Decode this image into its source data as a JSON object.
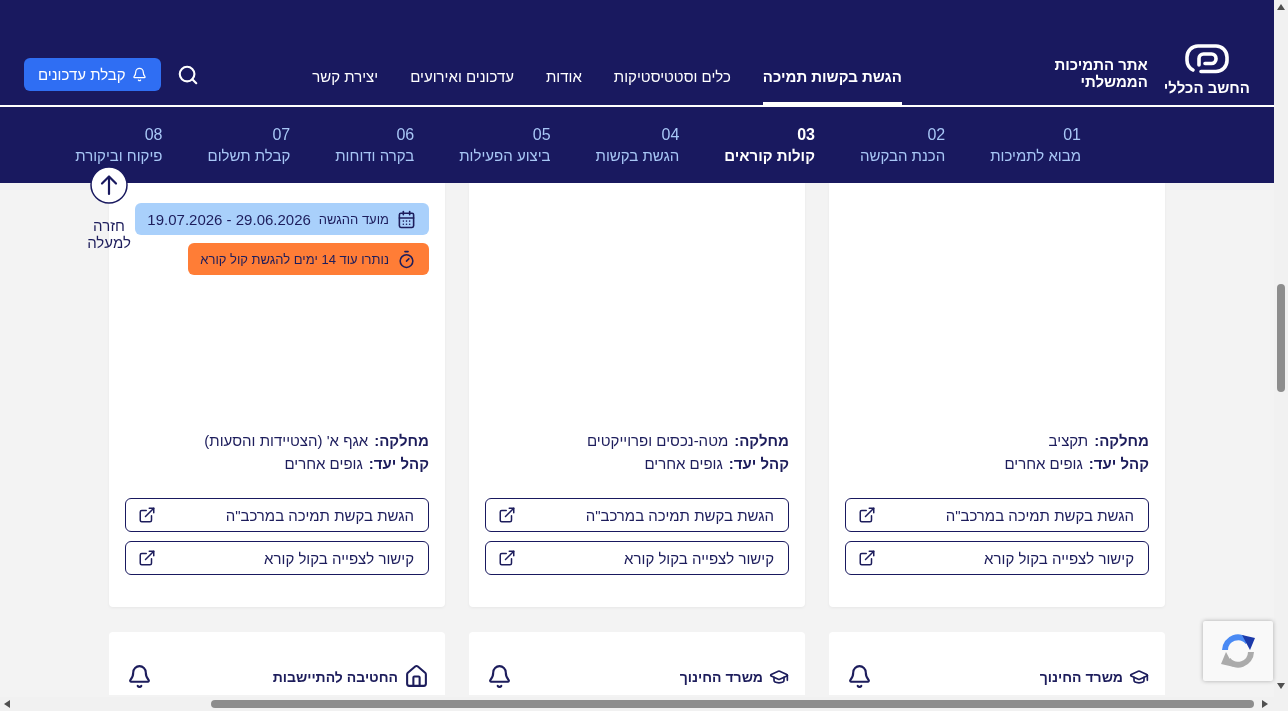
{
  "header": {
    "logo_text": "החשב הכללי",
    "site_title": "אתר התמיכות הממשלתי",
    "nav": [
      {
        "label": "הגשת בקשות תמיכה",
        "selected": true
      },
      {
        "label": "כלים וסטטיסטיקות",
        "selected": false
      },
      {
        "label": "אודות",
        "selected": false
      },
      {
        "label": "עדכונים ואירועים",
        "selected": false
      },
      {
        "label": "יצירת קשר",
        "selected": false
      }
    ],
    "subscribe_button": "קבלת עדכונים"
  },
  "steps": [
    {
      "number": "01",
      "label": "מבוא לתמיכות",
      "selected": false
    },
    {
      "number": "02",
      "label": "הכנת הבקשה",
      "selected": false
    },
    {
      "number": "03",
      "label": "קולות קוראים",
      "selected": true
    },
    {
      "number": "04",
      "label": "הגשת בקשות",
      "selected": false
    },
    {
      "number": "05",
      "label": "ביצוע הפעילות",
      "selected": false
    },
    {
      "number": "06",
      "label": "בקרה ודוחות",
      "selected": false
    },
    {
      "number": "07",
      "label": "קבלת תשלום",
      "selected": false
    },
    {
      "number": "08",
      "label": "פיקוח וביקורת",
      "selected": false
    }
  ],
  "back_to_top": "חזרה למעלה",
  "cards": [
    {
      "department": {
        "label": "מחלקה:",
        "value": "תקציב"
      },
      "audience": {
        "label": "קהל יעד:",
        "value": "גופים אחרים"
      },
      "buttons": [
        {
          "label": "הגשת בקשת תמיכה במרכב\"ה"
        },
        {
          "label": "קישור לצפייה בקול קורא"
        }
      ]
    },
    {
      "department": {
        "label": "מחלקה:",
        "value": "מטה-נכסים ופרוייקטים"
      },
      "audience": {
        "label": "קהל יעד:",
        "value": "גופים אחרים"
      },
      "buttons": [
        {
          "label": "הגשת בקשת תמיכה במרכב\"ה"
        },
        {
          "label": "קישור לצפייה בקול קורא"
        }
      ]
    },
    {
      "deadline": {
        "label": "מועד ההגשה",
        "dates": "29.06.2026 - 19.07.2026"
      },
      "countdown": "נותרו עוד 14 ימים להגשת קול קורא",
      "department": {
        "label": "מחלקה:",
        "value": "אגף א' (הצטיידות והסעות)"
      },
      "audience": {
        "label": "קהל יעד:",
        "value": "גופים אחרים"
      },
      "buttons": [
        {
          "label": "הגשת בקשת תמיכה במרכב\"ה"
        },
        {
          "label": "קישור לצפייה בקול קורא"
        }
      ]
    }
  ],
  "next_cards": [
    {
      "kind": "cap",
      "title": "משרד החינוך"
    },
    {
      "kind": "cap",
      "title": "משרד החינוך"
    },
    {
      "kind": "house",
      "title": "החטיבה להתיישבות"
    }
  ]
}
